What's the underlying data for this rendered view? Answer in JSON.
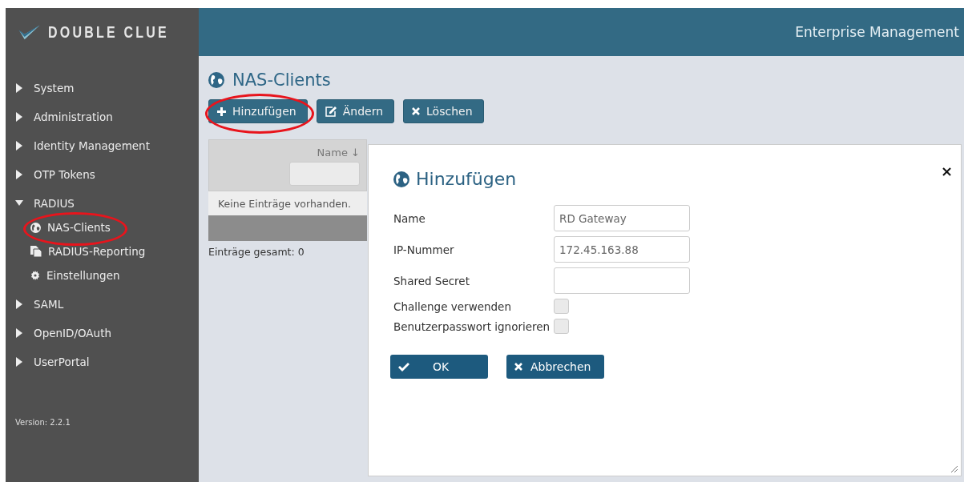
{
  "logo": {
    "text": "DOUBLE CLUE"
  },
  "header": {
    "title": "Enterprise Management"
  },
  "sidebar": {
    "items": [
      {
        "label": "System",
        "expanded": false,
        "circled": false
      },
      {
        "label": "Administration",
        "expanded": false,
        "circled": false
      },
      {
        "label": "Identity Management",
        "expanded": false,
        "circled": false
      },
      {
        "label": "OTP Tokens",
        "expanded": false,
        "circled": false
      },
      {
        "label": "RADIUS",
        "expanded": true,
        "circled": false,
        "children": [
          {
            "label": "NAS-Clients",
            "circled": true
          },
          {
            "label": "RADIUS-Reporting",
            "circled": false
          },
          {
            "label": "Einstellungen",
            "circled": false
          }
        ]
      },
      {
        "label": "SAML",
        "expanded": false,
        "circled": false
      },
      {
        "label": "OpenID/OAuth",
        "expanded": false,
        "circled": false
      },
      {
        "label": "UserPortal",
        "expanded": false,
        "circled": false
      }
    ],
    "version": "Version: 2.2.1"
  },
  "page": {
    "title": "NAS-Clients",
    "toolbar": [
      {
        "label": "Hinzufügen",
        "circled": true
      },
      {
        "label": "Ändern",
        "circled": false
      },
      {
        "label": "Löschen",
        "circled": false
      }
    ],
    "table": {
      "column": "Name",
      "sort_arrow": "↓",
      "empty_message": "Keine Einträge vorhanden."
    },
    "total": "Einträge gesamt: 0"
  },
  "dialog": {
    "title": "Hinzufügen",
    "close": "×",
    "fields": [
      {
        "kind": "text",
        "label": "Name",
        "value": "RD Gateway"
      },
      {
        "kind": "text",
        "label": "IP-Nummer",
        "value": "172.45.163.88"
      },
      {
        "kind": "text",
        "label": "Shared Secret"
      },
      {
        "kind": "checkbox",
        "label": "Challenge verwenden",
        "checked": false
      },
      {
        "kind": "checkbox",
        "label": "Benutzerpasswort ignorieren",
        "checked": false
      }
    ],
    "buttons": [
      {
        "label": "OK"
      },
      {
        "label": "Abbrechen"
      }
    ]
  }
}
